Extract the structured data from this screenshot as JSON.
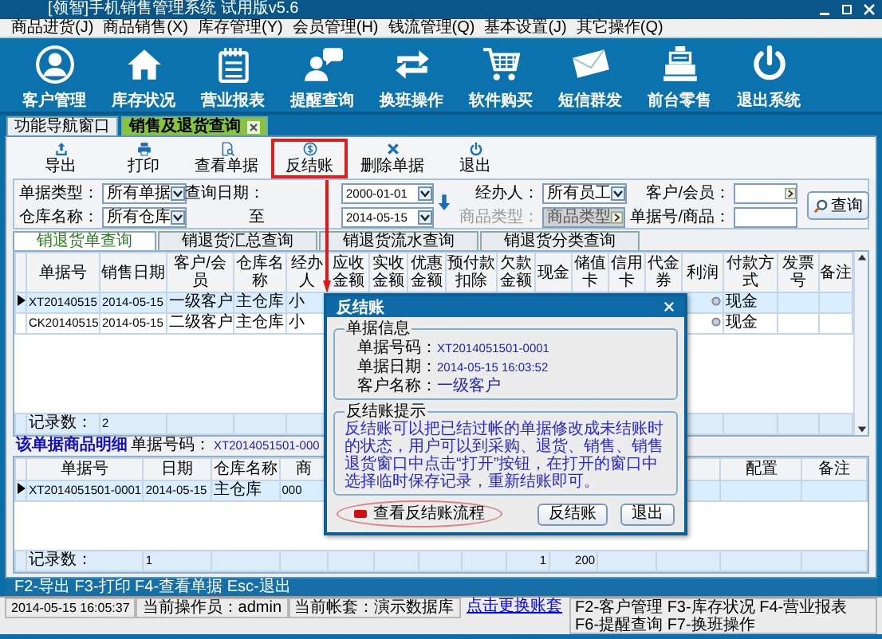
{
  "window": {
    "title": "[领智]手机销售管理系统 试用版v5.6"
  },
  "menu": [
    "商品进货(J)",
    "商品销售(X)",
    "库存管理(Y)",
    "会员管理(H)",
    "钱流管理(Q)",
    "基本设置(J)",
    "其它操作(Q)"
  ],
  "launcher": [
    "客户管理",
    "库存状况",
    "营业报表",
    "提醒查询",
    "换班操作",
    "软件购买",
    "短信群发",
    "前台零售",
    "退出系统"
  ],
  "tabs": [
    {
      "label": "功能导航窗口",
      "selected": false,
      "closable": false
    },
    {
      "label": "销售及退货查询",
      "selected": true,
      "closable": true
    }
  ],
  "toolbar": [
    {
      "label": "导出",
      "highlighted": false
    },
    {
      "label": "打印",
      "highlighted": false
    },
    {
      "label": "查看单据",
      "highlighted": false
    },
    {
      "label": "反结账",
      "highlighted": true
    },
    {
      "label": "删除单据",
      "highlighted": false
    },
    {
      "label": "退出",
      "highlighted": false
    }
  ],
  "filters": [
    {
      "label": "单据类型：",
      "kind": "select",
      "value": "所有单据",
      "disabled": false
    },
    {
      "label": "查询日期：",
      "kind": "date",
      "value": "2000-01-01",
      "disabled": false
    },
    {
      "label": "经办人：",
      "kind": "select",
      "value": "所有员工",
      "disabled": false
    },
    {
      "label": "客户/会员：",
      "kind": "picker",
      "disabled": false
    },
    {
      "label": "仓库名称：",
      "kind": "select",
      "value": "所有仓库",
      "disabled": false
    },
    {
      "label": "至",
      "kind": "date",
      "value": "2014-05-15",
      "disabled": false
    },
    {
      "label": "商品类型：",
      "kind": "picker",
      "placeholder": "商品类型",
      "disabled": true
    },
    {
      "label": "单据号/商品：",
      "kind": "input",
      "disabled": false
    }
  ],
  "search_button": "查询",
  "subtabs": [
    {
      "label": "销退货单查询",
      "selected": true
    },
    {
      "label": "销退货汇总查询",
      "selected": false
    },
    {
      "label": "销退货流水查询",
      "selected": false
    },
    {
      "label": "销退货分类查询",
      "selected": false
    }
  ],
  "orders": {
    "columns": [
      "单据号",
      "销售日期",
      "客户/会员",
      "仓库名称",
      "经办人",
      "应收金额",
      "实收金额",
      "优惠金额",
      "预付款扣除",
      "欠款金额",
      "现金",
      "储值卡",
      "信用卡",
      "代金券",
      "利润",
      "付款方式",
      "发票号",
      "备注"
    ],
    "rows": [
      {
        "selected": true,
        "cells": [
          "XT20140515",
          "2014-05-15",
          "一级客户",
          "主仓库",
          "小"
        ],
        "payment": "现金"
      },
      {
        "selected": false,
        "cells": [
          "CK20140515",
          "2014-05-15",
          "二级客户",
          "主仓库",
          "小"
        ],
        "payment": "现金"
      }
    ],
    "footer": {
      "label": "记录数：",
      "count": "2"
    }
  },
  "detail": {
    "title": "该单据商品明细",
    "doc_label": "单据号码：",
    "doc_no": "XT2014051501-000",
    "columns": [
      "单据号",
      "日期",
      "仓库名称",
      "商",
      "配置",
      "备注"
    ],
    "rows": [
      {
        "selected": true,
        "cells": [
          "XT2014051501-0001",
          "2014-05-15",
          "主仓库",
          "000"
        ]
      }
    ],
    "footer": {
      "label": "记录数：",
      "count": "1",
      "quantity": "1",
      "amount": "200"
    }
  },
  "shortcut_bar": "F2-导出 F3-打印 F4-查看单据 Esc-退出",
  "status": {
    "time": "2014-05-15 16:05:37",
    "operator": "当前操作员：admin",
    "account": "当前帐套：演示数据库",
    "switch_link": "点击更换账套",
    "shortcuts": "F2-客户管理 F3-库存状况 F4-营业报表 F6-提醒查询 F7-换班操作"
  },
  "dialog": {
    "title": "反结账",
    "info_group": "单据信息",
    "fields": [
      {
        "label": "单据号码：",
        "value": "XT2014051501-0001"
      },
      {
        "label": "单据日期：",
        "value": "2014-05-15 16:03:52"
      },
      {
        "label": "客户名称：",
        "value": "一级客户"
      }
    ],
    "hint_group": "反结账提示",
    "hint": "反结账可以把已结过帐的单据修改成未结账时的状态，用户可以到采购、退货、销售、销售退货窗口中点击“打开”按钮，在打开的窗口中选择临时保存记录，重新结账即可。",
    "flow_link": "查看反结账流程",
    "buttons": [
      "反结账",
      "退出"
    ]
  }
}
